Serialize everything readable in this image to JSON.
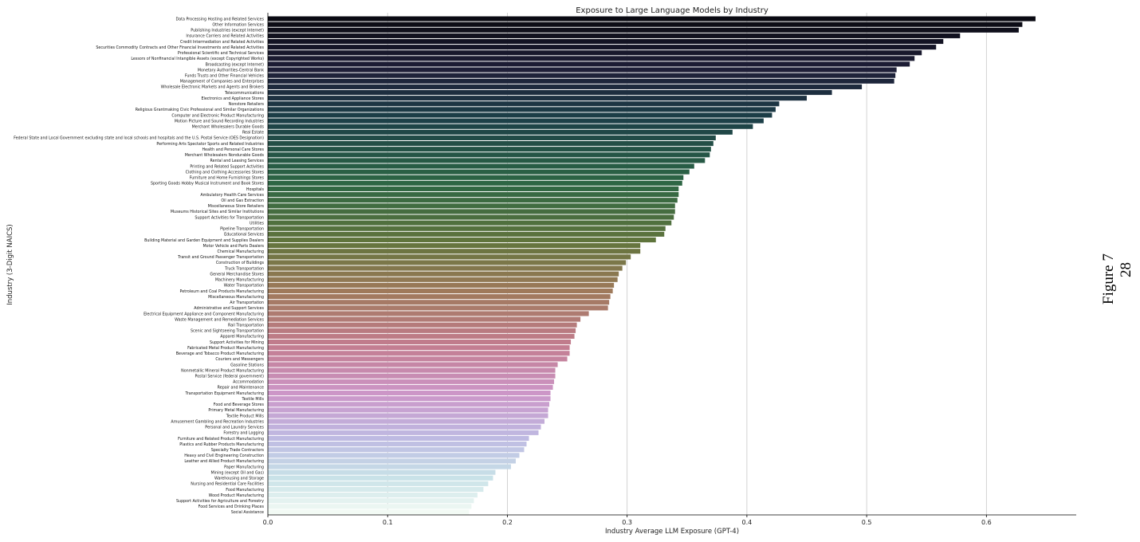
{
  "chart_data": {
    "type": "bar",
    "orientation": "horizontal",
    "title": "Exposure to Large Language Models by Industry",
    "xlabel": "Industry Average LLM Exposure (GPT-4)",
    "ylabel": "Industry (3-Digit NAICS)",
    "xlim": [
      0,
      0.675
    ],
    "xticks": [
      0.0,
      0.1,
      0.2,
      0.3,
      0.4,
      0.5,
      0.6
    ],
    "xtick_labels": [
      "0.0",
      "0.1",
      "0.2",
      "0.3",
      "0.4",
      "0.5",
      "0.6"
    ],
    "grid": "vertical",
    "legend": "none",
    "colormap": "cubehelix (dark to light)",
    "categories": [
      "Data Processing Hosting and Related Services",
      "Other Information Services",
      "Publishing Industries (except Internet)",
      "Insurance Carriers and Related Activities",
      "Credit Intermediation and Related Activities",
      "Securities Commodity Contracts and Other Financial Investments and Related Activities",
      "Professional Scientific and Technical Services",
      "Lessors of Nonfinancial Intangible Assets (except Copyrighted Works)",
      "Broadcasting (except Internet)",
      "Monetary Authorities-Central Bank",
      "Funds Trusts and Other Financial Vehicles",
      "Management of Companies and Enterprises",
      "Wholesale Electronic Markets and Agents and Brokers",
      "Telecommunications",
      "Electronics and Appliance Stores",
      "Nonstore Retailers",
      "Religious Grantmaking Civic Professional and Similar Organizations",
      "Computer and Electronic Product Manufacturing",
      "Motion Picture and Sound Recording Industries",
      "Merchant Wholesalers Durable Goods",
      "Real Estate",
      "Federal State and Local Government excluding state and local schools and hospitals and the U.S. Postal Service (OES Designation)",
      "Performing Arts Spectator Sports and Related Industries",
      "Health and Personal Care Stores",
      "Merchant Wholesalers Nondurable Goods",
      "Rental and Leasing Services",
      "Printing and Related Support Activities",
      "Clothing and Clothing Accessories Stores",
      "Furniture and Home Furnishings Stores",
      "Sporting Goods Hobby Musical Instrument and Book Stores",
      "Hospitals",
      "Ambulatory Health Care Services",
      "Oil and Gas Extraction",
      "Miscellaneous Store Retailers",
      "Museums Historical Sites and Similar Institutions",
      "Support Activities for Transportation",
      "Utilities",
      "Pipeline Transportation",
      "Educational Services",
      "Building Material and Garden Equipment and Supplies Dealers",
      "Motor Vehicle and Parts Dealers",
      "Chemical Manufacturing",
      "Transit and Ground Passenger Transportation",
      "Construction of Buildings",
      "Truck Transportation",
      "General Merchandise Stores",
      "Machinery Manufacturing",
      "Water Transportation",
      "Petroleum and Coal Products Manufacturing",
      "Miscellaneous Manufacturing",
      "Air Transportation",
      "Administrative and Support Services",
      "Electrical Equipment Appliance and Component Manufacturing",
      "Waste Management and Remediation Services",
      "Rail Transportation",
      "Scenic and Sightseeing Transportation",
      "Apparel Manufacturing",
      "Support Activities for Mining",
      "Fabricated Metal Product Manufacturing",
      "Beverage and Tobacco Product Manufacturing",
      "Couriers and Messengers",
      "Gasoline Stations",
      "Nonmetallic Mineral Product Manufacturing",
      "Postal Service (federal government)",
      "Accommodation",
      "Repair and Maintenance",
      "Transportation Equipment Manufacturing",
      "Textile Mills",
      "Food and Beverage Stores",
      "Primary Metal Manufacturing",
      "Textile Product Mills",
      "Amusement Gambling and Recreation Industries",
      "Personal and Laundry Services",
      "Forestry and Logging",
      "Furniture and Related Product Manufacturing",
      "Plastics and Rubber Products Manufacturing",
      "Specialty Trade Contractors",
      "Heavy and Civil Engineering Construction",
      "Leather and Allied Product Manufacturing",
      "Paper Manufacturing",
      "Mining (except Oil and Gas)",
      "Warehousing and Storage",
      "Nursing and Residential Care Facilities",
      "Food Manufacturing",
      "Wood Product Manufacturing",
      "Support Activities for Agriculture and Forestry",
      "Food Services and Drinking Places",
      "Social Assistance"
    ],
    "values": [
      0.641,
      0.63,
      0.627,
      0.578,
      0.564,
      0.558,
      0.546,
      0.54,
      0.536,
      0.525,
      0.524,
      0.523,
      0.496,
      0.471,
      0.45,
      0.427,
      0.424,
      0.421,
      0.414,
      0.405,
      0.388,
      0.374,
      0.372,
      0.37,
      0.369,
      0.365,
      0.356,
      0.352,
      0.347,
      0.346,
      0.343,
      0.343,
      0.342,
      0.34,
      0.34,
      0.339,
      0.337,
      0.332,
      0.331,
      0.324,
      0.311,
      0.311,
      0.303,
      0.299,
      0.296,
      0.293,
      0.292,
      0.289,
      0.288,
      0.286,
      0.285,
      0.284,
      0.268,
      0.261,
      0.258,
      0.257,
      0.256,
      0.253,
      0.252,
      0.252,
      0.25,
      0.242,
      0.24,
      0.24,
      0.239,
      0.238,
      0.236,
      0.236,
      0.235,
      0.234,
      0.234,
      0.231,
      0.228,
      0.226,
      0.218,
      0.216,
      0.214,
      0.21,
      0.207,
      0.203,
      0.19,
      0.188,
      0.184,
      0.18,
      0.175,
      0.172,
      0.17,
      0.168
    ]
  },
  "side_label": {
    "line1": "Figure 7",
    "line2": "28"
  }
}
